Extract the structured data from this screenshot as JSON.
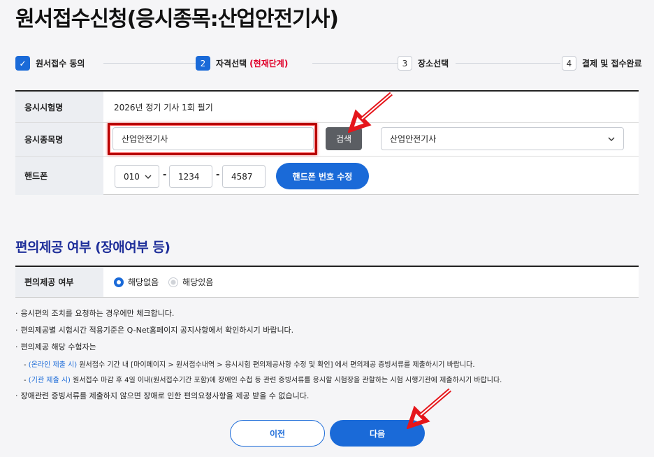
{
  "page": {
    "title": "원서접수신청(응시종목:산업안전기사)"
  },
  "stepper": {
    "steps": [
      {
        "num": "✓",
        "label": "원서접수 동의"
      },
      {
        "num": "2",
        "label": "자격선택",
        "current": "(현재단계)"
      },
      {
        "num": "3",
        "label": "장소선택"
      },
      {
        "num": "4",
        "label": "결제 및 접수완료"
      }
    ]
  },
  "form": {
    "exam_name_label": "응시시험명",
    "exam_name_value": "2026년 정기 기사 1회 필기",
    "subject_label": "응시종목명",
    "subject_input": "산업안전기사",
    "search_button": "검색",
    "subject_select": "산업안전기사",
    "phone_label": "핸드폰",
    "phone_prefix": "010",
    "phone_mid": "1234",
    "phone_last": "4587",
    "phone_edit_button": "핸드폰 번호 수정"
  },
  "convenience": {
    "section_title": "편의제공 여부 (장애여부 등)",
    "label": "편의제공 여부",
    "option_none": "해당없음",
    "option_yes": "해당있음",
    "selected": "해당없음"
  },
  "notes": {
    "n1": "응시편의 조치를 요청하는 경우에만 체크합니다.",
    "n2": "편의제공별 시험시간 적용기준은 Q-Net홈페이지 공지사항에서 확인하시기 바랍니다.",
    "n3": "편의제공 해당 수험자는",
    "s1_prefix": "- ",
    "s1_blue": "(온라인 제출 시)",
    "s1_rest": " 원서접수 기간 내 [마이페이지 > 원서접수내역 > 응시시험 편의제공사항 수정 및 확인] 에서 편의제공 증빙서류를 제출하시기 바랍니다.",
    "s2_prefix": "- ",
    "s2_blue": "(기관 제출 시)",
    "s2_rest": " 원서접수 마감 후 4일 이내(원서접수기간 포함)에 장애인 수첩 등 관련 증빙서류를 응시할 시험장을 관할하는 시험 시행기관에 제출하시기 바랍니다.",
    "n4": "장애관련 증빙서류를 제출하지 않으면 장애로 인한 편의요청사항을 제공 받을 수 없습니다."
  },
  "buttons": {
    "prev": "이전",
    "next": "다음"
  },
  "colors": {
    "accent": "#1a6ad8",
    "highlight": "#b80000",
    "arrow": "#e5161b"
  }
}
